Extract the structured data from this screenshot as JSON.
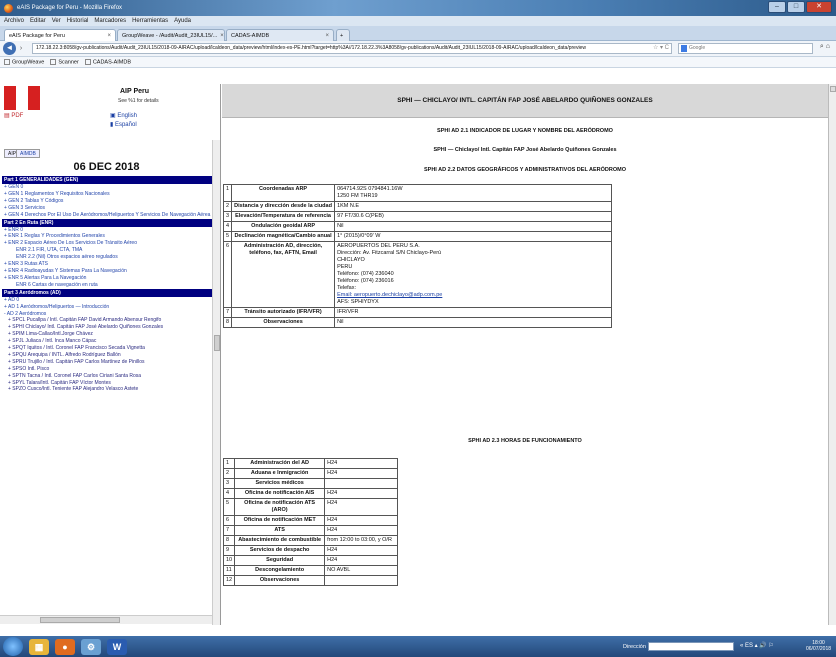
{
  "window": {
    "title": "eAIS Package for Peru - Mozilla Firefox",
    "buttons": {
      "min": "–",
      "max": "□",
      "close": "✕"
    }
  },
  "menubar": [
    "Archivo",
    "Editar",
    "Ver",
    "Historial",
    "Marcadores",
    "Herramientas",
    "Ayuda"
  ],
  "tabs": [
    {
      "label": "eAIS Package for Peru"
    },
    {
      "label": "GroupWeave - /Audit/Audit_23IUL15/..."
    },
    {
      "label": "CADAS-AIMDB"
    }
  ],
  "tab_new": "+",
  "nav": {
    "back": "◄",
    "url": "172.18.22.3:8058/gv-publications/Audit/Audit_23IUL15/2018-09-AIRAC/upload/lcaldeon_data/preview/html/index-es-PE.html?target=http%3A//172.18.22.3%3A8058/gv-publications/Audit/Audit_23IUL15/2018-09-AIRAC/upload/lcaldeon_data/preview",
    "search_placeholder": "Google"
  },
  "bookmarks": [
    "GroupWeave",
    "Scanner",
    "CADAS-AIMDB"
  ],
  "left": {
    "aip_title": "AIP Peru",
    "aip_sub": "See %1 for details",
    "pdf": "PDF",
    "english": "English",
    "spanish": "Español",
    "tab_aip": "AIP",
    "tab_aimdb": "AIMDB",
    "date": "06 DEC 2018",
    "toc": [
      {
        "t": "Part 1 GENERALIDADES (GEN)",
        "k": "hdr"
      },
      {
        "t": "+ GEN 0",
        "k": "i1"
      },
      {
        "t": "+ GEN 1 Reglamentos Y Requisitos Nacionales",
        "k": "i1"
      },
      {
        "t": "+ GEN 2 Tablas Y Códigos",
        "k": "i1"
      },
      {
        "t": "+ GEN 3 Servicios",
        "k": "i1"
      },
      {
        "t": "+ GEN 4 Derechos Por El Uso De Aeródromos/Helipuertos Y Servicios De Navegación Aérea",
        "k": "i1"
      },
      {
        "t": "Part 2 En Ruta (ENR)",
        "k": "hdr"
      },
      {
        "t": "+ ENR 0",
        "k": "i1"
      },
      {
        "t": "+ ENR 1 Reglas Y Procedimientos Generales",
        "k": "i1"
      },
      {
        "t": "+ ENR 2 Espacio Aéreo De Los Servicios De Tránsito Aéreo",
        "k": "i1"
      },
      {
        "t": "ENR 2.1 FIR, UTA, CTA, TMA",
        "k": "i2"
      },
      {
        "t": "ENR 2.2 (Nil) Otros espacios aéreo regulados",
        "k": "i2"
      },
      {
        "t": "+ ENR 3 Rutas ATS",
        "k": "i1"
      },
      {
        "t": "+ ENR 4 Radioayudas Y Sistemas Para La Navegación",
        "k": "i1"
      },
      {
        "t": "+ ENR 5 Alertas Para La Navegación",
        "k": "i1"
      },
      {
        "t": "ENR 6 Cartas de navegación en ruta",
        "k": "i2"
      },
      {
        "t": "Part 3 Aeródromos (AD)",
        "k": "hdr"
      },
      {
        "t": "+ AD 0",
        "k": "i1"
      },
      {
        "t": "+ AD 1 Aeródromos/Helipuertos — Introducción",
        "k": "i1"
      },
      {
        "t": "- AD 2 Aeródromos",
        "k": "i1"
      },
      {
        "t": "+ SPCL Pucallpa / Intl. Capitán FAP David Armando Abensur Rengifo",
        "k": "i3"
      },
      {
        "t": "+ SPHI Chiclayo/ Intl. Capitán FAP José Abelardo Quiñones Gonzales",
        "k": "i3"
      },
      {
        "t": "+ SPIM Lima-Callao/Intl.Jorge Chávez",
        "k": "i3"
      },
      {
        "t": "+ SPJL Juliaca / Intl. Inca Manco Cápac",
        "k": "i3"
      },
      {
        "t": "+ SPQT Iquitos / Intl. Coronel FAP Francisco Secada Vignetta",
        "k": "i3"
      },
      {
        "t": "+ SPQU Arequipa / INTL. Alfredo Rodríguez Ballón",
        "k": "i3"
      },
      {
        "t": "+ SPRU Trujillo / Intl. Capitán FAP Carlos Martínez de Pinillos",
        "k": "i3"
      },
      {
        "t": "+ SPSO Intl. Pisco",
        "k": "i3"
      },
      {
        "t": "+ SPTN Tacna / Intl. Coronel FAP Carlos Ciriani Santa Rosa",
        "k": "i3"
      },
      {
        "t": "+ SPYL Talara/Intl. Capitán FAP Víctor Montes",
        "k": "i3"
      },
      {
        "t": "+ SPZO Cusco/Intl. Teniente FAP Alejandro Velasco Astete",
        "k": "i3"
      }
    ]
  },
  "right": {
    "header": "SPHI — CHICLAYO/ INTL. CAPITÁN FAP JOSÉ ABELARDO QUIÑONES GONZALES",
    "s21": "SPHI AD 2.1 INDICADOR DE LUGAR Y NOMBRE DEL AERÓDROMO",
    "name": "SPHI — Chiclayo/ Intl. Capitán FAP José Abelardo Quiñones Gonzales",
    "s22": "SPHI AD 2.2 DATOS GEOGRÁFICOS Y ADMINISTRATIVOS DEL AERÓDROMO",
    "t22": [
      {
        "n": "1",
        "l": "Coordenadas ARP",
        "v": [
          "064714.92S  0794841.16W",
          "1250 FM THR19"
        ]
      },
      {
        "n": "2",
        "l": "Distancia y dirección desde la ciudad",
        "v": [
          "1KM N.E"
        ]
      },
      {
        "n": "3",
        "l": "Elevación/Temperatura de referencia",
        "v": [
          "97 FT/30.6 C(PEB)"
        ]
      },
      {
        "n": "4",
        "l": "Ondulación geoidal ARP",
        "v": [
          "Nil"
        ]
      },
      {
        "n": "5",
        "l": "Declinación magnética/Cambio anual",
        "v": [
          "1° (2015)/0°09' W"
        ]
      },
      {
        "n": "6",
        "l": "Administración AD, dirección, teléfono, fax, AFTN, Email",
        "v": [
          "AEROPUERTOS DEL PERU S.A.",
          "Dirección: Av. Fitzcarral S/N Chiclayo-Perú",
          "CHICLAYO",
          "PERU",
          "Teléfono: (074) 236040",
          "Teléfono: (074) 236016",
          "Telefax:",
          "Email:    aeropuerto.dechiclayo@adp.com.pe",
          "AFS:     SPHIYDYX"
        ]
      },
      {
        "n": "7",
        "l": "Tránsito autorizado (IFR/VFR)",
        "v": [
          "IFR/VFR"
        ]
      },
      {
        "n": "8",
        "l": "Observaciones",
        "v": [
          "Nil"
        ]
      }
    ],
    "s23": "SPHI AD 2.3 HORAS DE FUNCIONAMIENTO",
    "t23": [
      {
        "n": "1",
        "l": "Administración del AD",
        "v": "H24"
      },
      {
        "n": "2",
        "l": "Aduana e Inmigración",
        "v": "H24"
      },
      {
        "n": "3",
        "l": "Servicios médicos",
        "v": ""
      },
      {
        "n": "4",
        "l": "Oficina de notificación AIS",
        "v": "H24"
      },
      {
        "n": "5",
        "l": "Oficina de notificación ATS (ARO)",
        "v": "H24"
      },
      {
        "n": "6",
        "l": "Oficina de notificación MET",
        "v": "H24"
      },
      {
        "n": "7",
        "l": "ATS",
        "v": "H24"
      },
      {
        "n": "8",
        "l": "Abastecimiento de combustible",
        "v": "from 12:00 to 03:00, y O/R"
      },
      {
        "n": "9",
        "l": "Servicios de despacho",
        "v": "H24"
      },
      {
        "n": "10",
        "l": "Seguridad",
        "v": "H24"
      },
      {
        "n": "11",
        "l": "Descongelamiento",
        "v": "NO AVBL"
      },
      {
        "n": "12",
        "l": "Observaciones",
        "v": ""
      }
    ]
  },
  "taskbar": {
    "direccion": "Dirección",
    "clock_time": "18:00",
    "clock_date": "06/07/2018",
    "tray": "« ES ▴ 🔊 ⚐"
  },
  "colors": {
    "toc_header": "#000080",
    "link": "#1a3fa3"
  }
}
